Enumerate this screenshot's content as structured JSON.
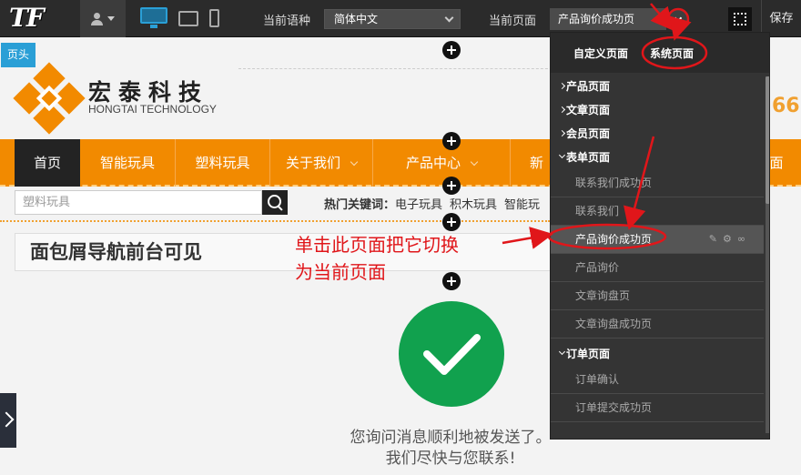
{
  "toolbar": {
    "logo": "TF",
    "language_label": "当前语种",
    "language_value": "简体中文",
    "page_label": "当前页面",
    "page_value": "产品询价成功页",
    "save_label": "保存"
  },
  "header": {
    "tag": "页头",
    "brand_name": "宏泰科技",
    "brand_sub": "HONGTAI TECHNOLOGY",
    "phone_tail": "66",
    "brand_colors": {
      "orange": "#f28a00",
      "dark": "#232323",
      "blue": "#2a9fd6"
    }
  },
  "nav": {
    "items": [
      {
        "label": "首页"
      },
      {
        "label": "智能玩具"
      },
      {
        "label": "塑料玩具"
      },
      {
        "label": "关于我们"
      },
      {
        "label": "产品中心"
      },
      {
        "label": "新闻"
      },
      {
        "label": "面"
      }
    ]
  },
  "search": {
    "placeholder": "塑料玩具",
    "hot_label": "热门关键词：",
    "hot_words": [
      "电子玩具",
      "积木玩具",
      "智能玩"
    ]
  },
  "breadcrumb": {
    "text": "面包屑导航前台可见"
  },
  "success": {
    "line1": "您询问消息顺利地被发送了。",
    "line2": "我们尽快与您联系!",
    "color": "#11a14e"
  },
  "annotation": {
    "line1": "单击此页面把它切换",
    "line2": "为当前页面",
    "color": "#e0161a"
  },
  "dropdown": {
    "tabs": [
      "自定义页面",
      "系统页面"
    ],
    "active_tab": "系统页面",
    "groups": [
      {
        "label": "产品页面",
        "items": []
      },
      {
        "label": "文章页面",
        "items": []
      },
      {
        "label": "会员页面",
        "items": []
      },
      {
        "label": "表单页面",
        "items": [
          "联系我们成功页",
          "联系我们",
          "产品询价成功页",
          "产品询价",
          "文章询盘页",
          "文章询盘成功页"
        ]
      },
      {
        "label": "订单页面",
        "items": [
          "订单确认",
          "订单提交成功页"
        ]
      }
    ],
    "highlighted_item": "产品询价成功页"
  }
}
